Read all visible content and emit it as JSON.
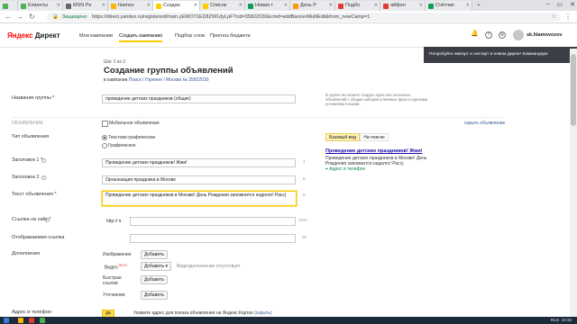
{
  "browser": {
    "tabs": [
      {
        "label": "Клиенты",
        "color": "#4caf50"
      },
      {
        "label": "MSN Pe",
        "color": "#666666"
      },
      {
        "label": "hiamov",
        "color": "#ffb300"
      },
      {
        "label": "Создан",
        "color": "#ffcc00"
      },
      {
        "label": "Список",
        "color": "#ffcc00"
      },
      {
        "label": "Новая т",
        "color": "#0f9d58"
      },
      {
        "label": "День Р",
        "color": "#ff9800"
      },
      {
        "label": "Подбо",
        "color": "#e53935"
      },
      {
        "label": "айфон",
        "color": "#e53935"
      },
      {
        "label": "Счётчик",
        "color": "#0f9d58"
      }
    ],
    "secure_label": "Защищено",
    "url": "https://direct.yandex.ru/registered/main.yEWOT1ED8ZW1dyLpF?cid=35822030&cmd=addBannerMultiEdit&from_newCamp=1"
  },
  "header": {
    "logo_ya": "Яндекс",
    "logo_direct": "Директ",
    "nav": [
      "Мои кампании",
      "Создать кампанию",
      "Подбор слов",
      "Прогноз бюджета"
    ],
    "username": "sk.hlamovozov"
  },
  "popup": {
    "text": "Попробуйте импорт и экспорт в новом Директ Коммандере",
    "close": "×"
  },
  "page": {
    "step": "Шаг 2 из 2",
    "title": "Создание группы объявлений",
    "campaign_prefix": "в кампании",
    "campaign_link": "Поиск / Горение / Москва",
    "campaign_id": "№ 35822030"
  },
  "form": {
    "group_name_label": "Название группы *",
    "group_name_value": "проведение детских праздников (общие)",
    "group_note": "В группе вы можете создать одно или несколько объявлений с общим набором ключевых фраз и едиными условиями показов.",
    "ad_section_label": "Объявление",
    "mobile_ad": "Мобильное объявление",
    "show_link": "скрыть объявление",
    "type_label": "Тип объявления",
    "type_text_graphic": "Текстово-графическое",
    "type_graphic": "Графическое",
    "title1_label": "Заголовок 1 *",
    "title1_value": "Проведение детских праздников! Жми!",
    "title1_count": "4",
    "title2_label": "Заголовок 2",
    "title2_value": "Организация праздника в Москве",
    "title2_count": "8",
    "text_label": "Текст объявления *",
    "text_value": "Проведение детских праздников в Москве! День Рождения запомнится надолго! Расс|",
    "text_count": "0",
    "link_label": "Ссылка на сайт *",
    "protocol": "http://",
    "link_count": "1017",
    "display_link_label": "Отображаемая ссылка",
    "display_link_count": "20",
    "extras_label": "Дополнения",
    "image_label": "Изображение",
    "add_label": "Добавить",
    "video_label": "Видео",
    "video_badge": "BETA",
    "video_note": "Видеодополнение отсутствует",
    "quicklinks_label": "Быстрые ссылки",
    "clarifications_label": "Уточнения",
    "address_label": "Адрес и телефон",
    "yes_label": "да",
    "address_note": "Укажите адрес для показа объявления на Яндекс.Картах",
    "address_hide": "(скрыть)"
  },
  "preview": {
    "tab_basic": "Базовый вид",
    "tab_search": "На поиске",
    "title": "Проведение детских праздников! Жми!",
    "text": "Проведение детских праздников в Москве! День Рождения запомнится надолго! Расс|",
    "address": "Адрес и телефон"
  },
  "taskbar": {
    "lang": "RUS",
    "time": "10:33"
  }
}
